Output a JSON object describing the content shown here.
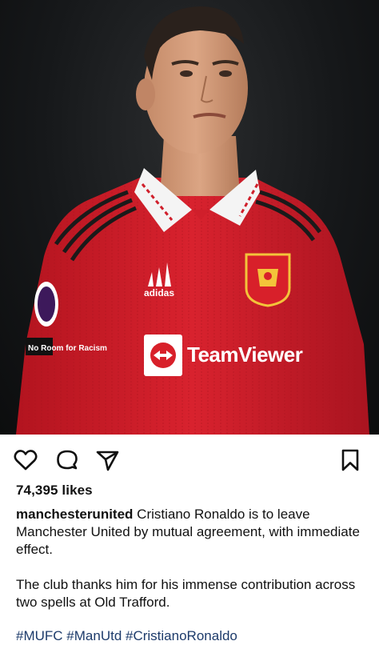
{
  "post": {
    "likes_text": "74,395 likes",
    "username": "manchesterunited",
    "caption_line1": "Cristiano Ronaldo is to leave Manchester United by mutual agreement, with immediate effect.",
    "caption_line2": "The club thanks him for his immense contribution across two spells at Old Trafford.",
    "hashtags": [
      "#MUFC",
      "#ManUtd",
      "#CristianoRonaldo"
    ]
  },
  "icons": {
    "like": "heart-icon",
    "comment": "comment-bubble-icon",
    "share": "paper-plane-icon",
    "save": "bookmark-icon"
  },
  "image": {
    "kit_brand": "adidas",
    "sponsor": "TeamViewer",
    "sleeve_text": "No Room for Racism",
    "colors": {
      "shirt": "#d01f2b",
      "collar": "#ffffff",
      "background": "#141618"
    }
  }
}
